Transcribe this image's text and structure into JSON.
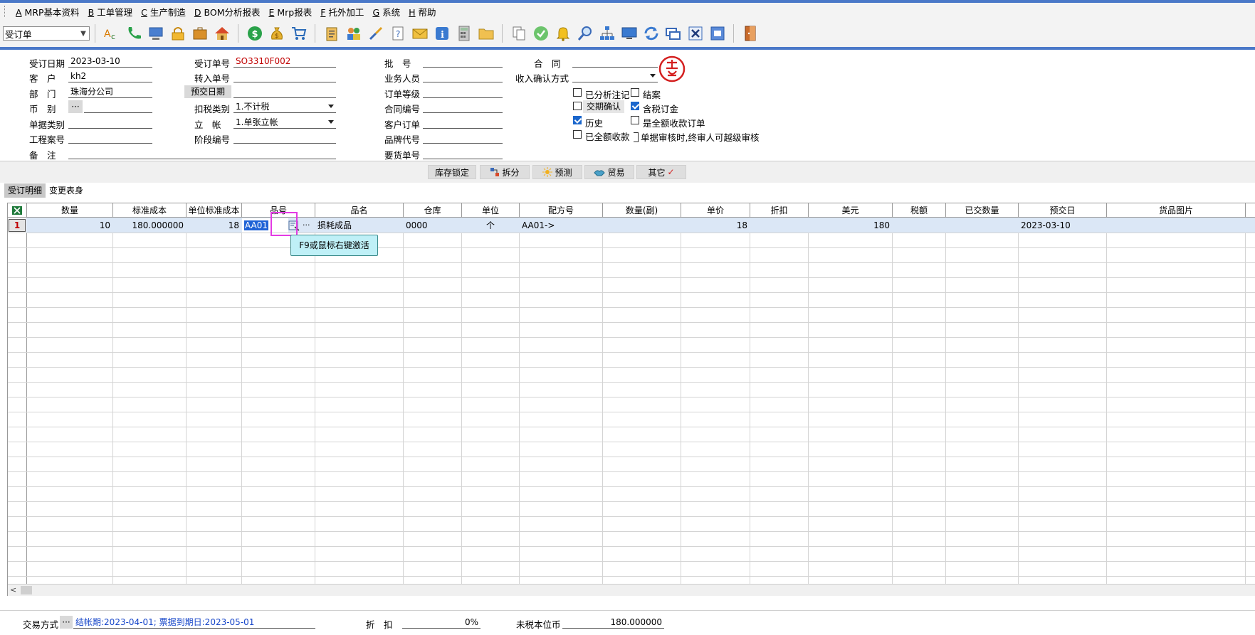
{
  "menu": [
    {
      "key": "A",
      "label": "MRP基本资料"
    },
    {
      "key": "B",
      "label": "工单管理"
    },
    {
      "key": "C",
      "label": "生产制造"
    },
    {
      "key": "D",
      "label": "BOM分析报表"
    },
    {
      "key": "E",
      "label": "Mrp报表"
    },
    {
      "key": "F",
      "label": "托外加工"
    },
    {
      "key": "G",
      "label": "系统"
    },
    {
      "key": "H",
      "label": "帮助"
    }
  ],
  "toolbar": {
    "doc_type": "受订单"
  },
  "header": {
    "order_date_label": "受订日期",
    "order_date": "2023-03-10",
    "customer_label": "客　户",
    "customer": "kh2",
    "dept_label": "部　门",
    "dept": "珠海分公司",
    "currency_label": "币　别",
    "currency_btn": "···",
    "doc_category_label": "单据类别",
    "project_label": "工程案号",
    "remark_label": "备　注",
    "order_no_label": "受订单号",
    "order_no": "SO3310F002",
    "transfer_no_label": "转入单号",
    "pre_delivery_label": "预交日期",
    "tax_type_label": "扣税类别",
    "tax_type": "1.不计税",
    "account_label": "立　帐",
    "account": "1.单张立帐",
    "stage_no_label": "阶段编号",
    "batch_label": "批　号",
    "salesperson_label": "业务人员",
    "order_level_label": "订单等级",
    "contract_no_label": "合同编号",
    "customer_order_label": "客户订单",
    "brand_code_label": "品牌代号",
    "request_no_label": "要货单号",
    "contract_label": "合　同",
    "income_confirm_label": "收入确认方式",
    "cb_analyzed": "已分析注记",
    "cb_closed": "结案",
    "cb_period_confirm": "交期确认",
    "cb_tax_included": "含税订金",
    "cb_history": "历史",
    "cb_full_payment_order": "是全额收款订单",
    "cb_full_received": "已全额收款",
    "cb_final_audit": "单据审核时,终审人可越级审核"
  },
  "actions": [
    {
      "label": "库存锁定"
    },
    {
      "label": "拆分"
    },
    {
      "label": "预测"
    },
    {
      "label": "贸易"
    },
    {
      "label": "其它"
    }
  ],
  "tabs": [
    {
      "label": "受订明细"
    },
    {
      "label": "变更表身"
    }
  ],
  "grid": {
    "columns": [
      "数量",
      "标准成本",
      "单位标准成本",
      "品号",
      "品名",
      "仓库",
      "单位",
      "配方号",
      "数量(副)",
      "单价",
      "折扣",
      "美元",
      "税额",
      "已交数量",
      "预交日",
      "货品图片"
    ],
    "row": {
      "no": "1",
      "qty": "10",
      "std_cost": "180.000000",
      "unit_std_cost": "18",
      "item_no": "AA01",
      "item_name": "损耗成品",
      "warehouse": "0000",
      "unit": "个",
      "formula": "AA01->",
      "price": "18",
      "usd": "180",
      "pre_date": "2023-03-10"
    },
    "tooltip": "F9或鼠标右键激活"
  },
  "footer": {
    "trade_label": "交易方式",
    "trade_value": "结帐期:2023-04-01; 票据到期日:2023-05-01",
    "discount_label": "折　扣",
    "discount_value": "0%",
    "untaxed_label": "未税本位币",
    "untaxed_value": "180.000000"
  },
  "colors": {
    "accent": "#4a78c8",
    "selection": "#dbe7f6",
    "tooltip": "#bff0f7",
    "highlight": "#e33ae3"
  }
}
